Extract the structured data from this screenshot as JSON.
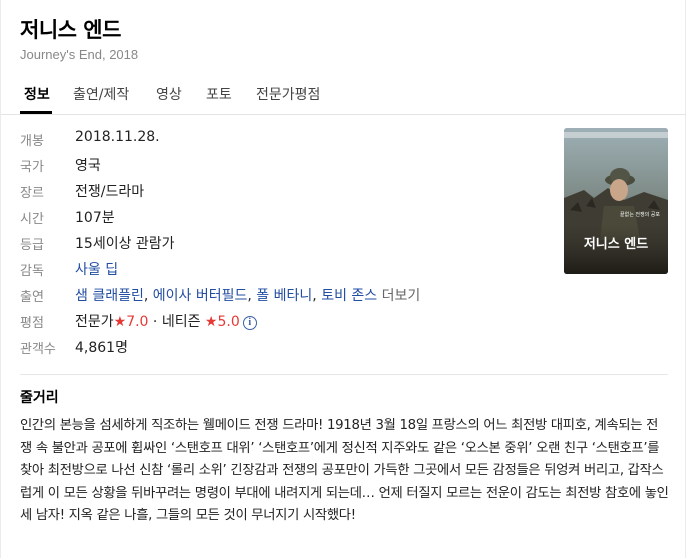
{
  "header": {
    "title": "저니스 엔드",
    "subtitle": "Journey's End, 2018"
  },
  "tabs": [
    {
      "label": "정보",
      "active": true
    },
    {
      "label": "출연/제작",
      "active": false
    },
    {
      "label": "영상",
      "active": false
    },
    {
      "label": "포토",
      "active": false
    },
    {
      "label": "전문가평점",
      "active": false
    }
  ],
  "info": {
    "release": {
      "label": "개봉",
      "value": "2018.11.28."
    },
    "country": {
      "label": "국가",
      "value": "영국"
    },
    "genre": {
      "label": "장르",
      "value": "전쟁/드라마"
    },
    "runtime": {
      "label": "시간",
      "value": "107분"
    },
    "rating": {
      "label": "등급",
      "value": "15세이상 관람가"
    },
    "director": {
      "label": "감독",
      "value": "사울 딥"
    },
    "cast": {
      "label": "출연",
      "names": [
        "샘 클래플린",
        "에이사 버터필드",
        "폴 베타니",
        "토비 존스"
      ],
      "separator": ",",
      "more": "더보기"
    },
    "score": {
      "label": "평점",
      "critic_label": "전문가",
      "critic_star": "★",
      "critic_value": "7.0",
      "dot": "·",
      "netizen_label": "네티즌",
      "netizen_star": "★",
      "netizen_value": "5.0",
      "info_icon": "i"
    },
    "audience": {
      "label": "관객수",
      "value": "4,861명"
    }
  },
  "poster": {
    "title_text": "저니스 엔드",
    "tagline": "끝없는 전쟁의 공포",
    "colors": {
      "sky": "#8fa0a8",
      "ground": "#2e2c24",
      "title": "#ffffff"
    }
  },
  "synopsis": {
    "heading": "줄거리",
    "text": "인간의 본능을 섬세하게 직조하는 웰메이드 전쟁 드라마! 1918년 3월 18일 프랑스의 어느 최전방 대피호, 계속되는 전쟁 속 불안과 공포에 휩싸인 ‘스탠호프 대위’ ‘스탠호프’에게 정신적 지주와도 같은 ‘오스본 중위’ 오랜 친구 ‘스탠호프’를 찾아 최전방으로 나선 신참 ‘롤리 소위’ 긴장감과 전쟁의 공포만이 가득한 그곳에서 모든 감정들은 뒤엉켜 버리고, 갑작스럽게 이 모든 상황을 뒤바꾸려는 명령이 부대에 내려지게 되는데… 언제 터질지 모르는 전운이 감도는 최전방 참호에 놓인 세 남자! 지옥 같은 나흘, 그들의 모든 것이 무너지기 시작했다!"
  }
}
